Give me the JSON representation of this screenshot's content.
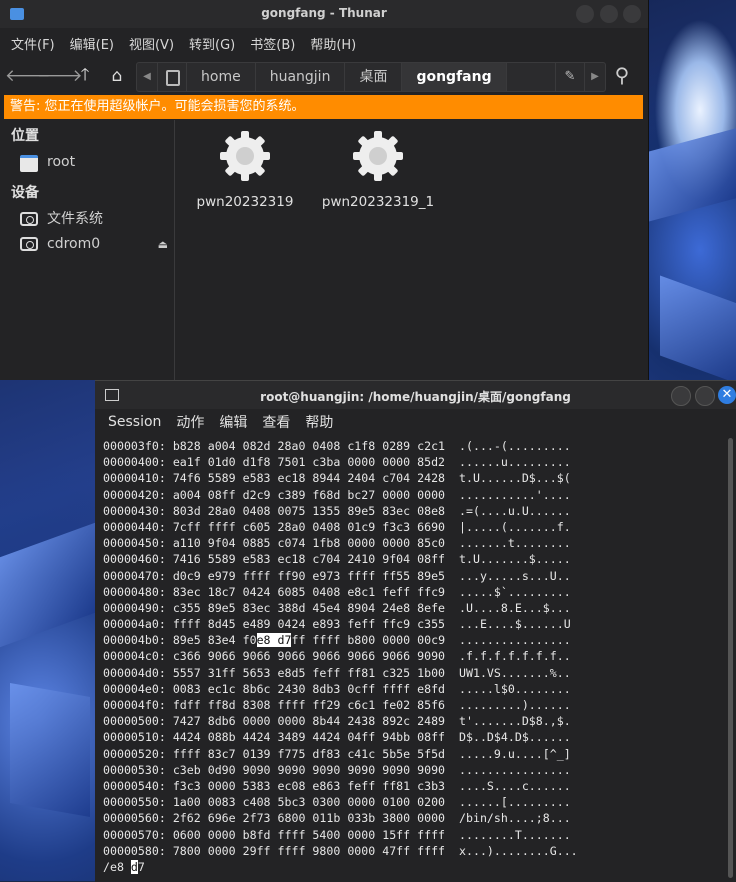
{
  "thunar": {
    "title": "gongfang - Thunar",
    "menu": [
      "文件(F)",
      "编辑(E)",
      "视图(V)",
      "转到(G)",
      "书签(B)",
      "帮助(H)"
    ],
    "path": [
      "home",
      "huangjin",
      "桌面",
      "gongfang"
    ],
    "warning": "警告: 您正在使用超级帐户。可能会损害您的系统。",
    "sidebar": {
      "places_heading": "位置",
      "places": [
        {
          "label": "root",
          "icon": "folder-icon"
        }
      ],
      "devices_heading": "设备",
      "devices": [
        {
          "label": "文件系统",
          "icon": "drive-icon"
        },
        {
          "label": "cdrom0",
          "icon": "drive-icon"
        }
      ]
    },
    "files": [
      {
        "name": "pwn20232319",
        "icon": "gear-icon"
      },
      {
        "name": "pwn20232319_1",
        "icon": "gear-icon"
      }
    ]
  },
  "terminal": {
    "title": "root@huangjin: /home/huangjin/桌面/gongfang",
    "menu": [
      "Session",
      "动作",
      "编辑",
      "查看",
      "帮助"
    ],
    "lines": [
      {
        "addr": "000003f0:",
        "hex": "b828 a004 082d 28a0 0408 c1f8 0289 c2c1",
        "ascii": ".(...-(........."
      },
      {
        "addr": "00000400:",
        "hex": "ea1f 01d0 d1f8 7501 c3ba 0000 0000 85d2",
        "ascii": "......u........."
      },
      {
        "addr": "00000410:",
        "hex": "74f6 5589 e583 ec18 8944 2404 c704 2428",
        "ascii": "t.U......D$...$("
      },
      {
        "addr": "00000420:",
        "hex": "a004 08ff d2c9 c389 f68d bc27 0000 0000",
        "ascii": "...........'...."
      },
      {
        "addr": "00000430:",
        "hex": "803d 28a0 0408 0075 1355 89e5 83ec 08e8",
        "ascii": ".=(....u.U......"
      },
      {
        "addr": "00000440:",
        "hex": "7cff ffff c605 28a0 0408 01c9 f3c3 6690",
        "ascii": "|.....(.......f."
      },
      {
        "addr": "00000450:",
        "hex": "a110 9f04 0885 c074 1fb8 0000 0000 85c0",
        "ascii": ".......t........"
      },
      {
        "addr": "00000460:",
        "hex": "7416 5589 e583 ec18 c704 2410 9f04 08ff",
        "ascii": "t.U.......$....."
      },
      {
        "addr": "00000470:",
        "hex": "d0c9 e979 ffff ff90 e973 ffff ff55 89e5",
        "ascii": "...y.....s...U.."
      },
      {
        "addr": "00000480:",
        "hex": "83ec 18c7 0424 6085 0408 e8c1 feff ffc9",
        "ascii": ".....$`........."
      },
      {
        "addr": "00000490:",
        "hex": "c355 89e5 83ec 388d 45e4 8904 24e8 8efe",
        "ascii": ".U....8.E...$..."
      },
      {
        "addr": "000004a0:",
        "hex": "ffff 8d45 e489 0424 e893 feff ffc9 c355",
        "ascii": "...E....$......U"
      },
      {
        "addr": "000004b0:",
        "hex": "89e5 83e4 f0e8 d7ff ffff b800 0000 00c9",
        "ascii": "................"
      },
      {
        "addr": "000004c0:",
        "hex": "c366 9066 9066 9066 9066 9066 9066 9090",
        "ascii": ".f.f.f.f.f.f.f.."
      },
      {
        "addr": "000004d0:",
        "hex": "5557 31ff 5653 e8d5 feff ff81 c325 1b00",
        "ascii": "UW1.VS.......%.."
      },
      {
        "addr": "000004e0:",
        "hex": "0083 ec1c 8b6c 2430 8db3 0cff ffff e8fd",
        "ascii": ".....l$0........"
      },
      {
        "addr": "000004f0:",
        "hex": "fdff ff8d 8308 ffff ff29 c6c1 fe02 85f6",
        "ascii": ".........)......"
      },
      {
        "addr": "00000500:",
        "hex": "7427 8db6 0000 0000 8b44 2438 892c 2489",
        "ascii": "t'.......D$8.,$."
      },
      {
        "addr": "00000510:",
        "hex": "4424 088b 4424 3489 4424 04ff 94bb 08ff",
        "ascii": "D$..D$4.D$......"
      },
      {
        "addr": "00000520:",
        "hex": "ffff 83c7 0139 f775 df83 c41c 5b5e 5f5d",
        "ascii": ".....9.u....[^_]"
      },
      {
        "addr": "00000530:",
        "hex": "c3eb 0d90 9090 9090 9090 9090 9090 9090",
        "ascii": "................"
      },
      {
        "addr": "00000540:",
        "hex": "f3c3 0000 5383 ec08 e863 feff ff81 c3b3",
        "ascii": "....S....c......"
      },
      {
        "addr": "00000550:",
        "hex": "1a00 0083 c408 5bc3 0300 0000 0100 0200",
        "ascii": "......[........."
      },
      {
        "addr": "00000560:",
        "hex": "2f62 696e 2f73 6800 011b 033b 3800 0000",
        "ascii": "/bin/sh....;8..."
      },
      {
        "addr": "00000570:",
        "hex": "0600 0000 b8fd ffff 5400 0000 15ff ffff",
        "ascii": "........T......."
      },
      {
        "addr": "00000580:",
        "hex": "7800 0000 29ff ffff 9800 0000 47ff ffff",
        "ascii": "x...)........G..."
      }
    ],
    "highlight_line": 12,
    "highlight_text": "e8 d7",
    "search_prompt": "/e8 ",
    "search_cursor": "d",
    "search_rest": "7"
  },
  "colors": {
    "warning": "#ff8c00",
    "window_bg": "#232325"
  }
}
